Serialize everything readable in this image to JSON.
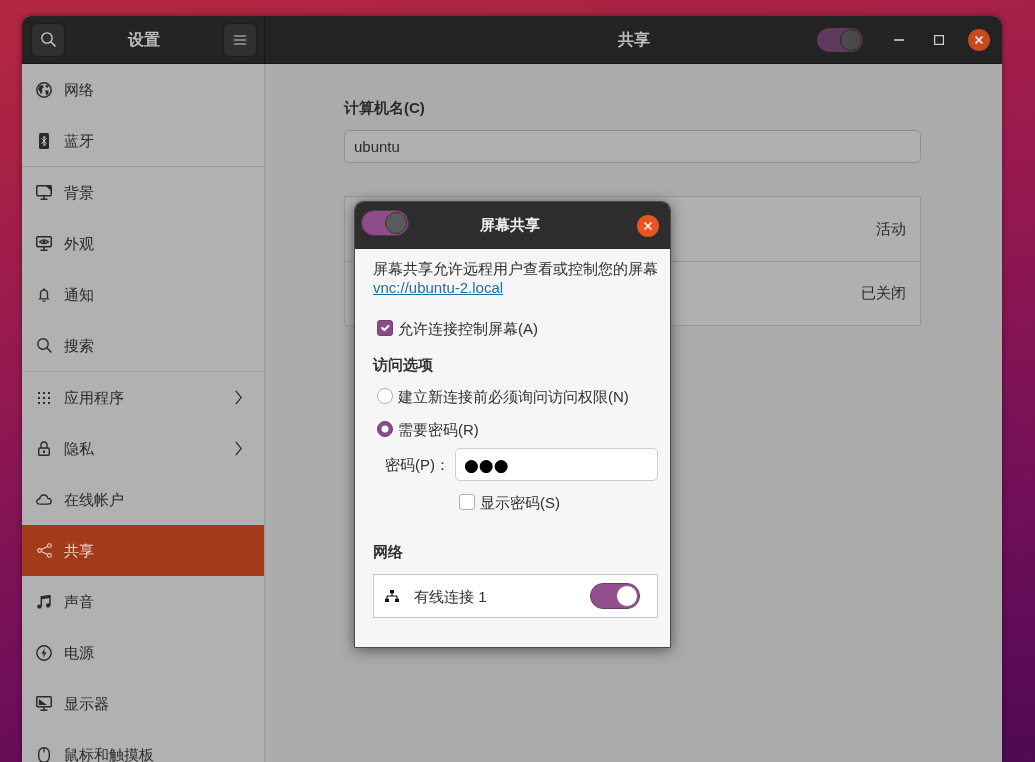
{
  "header": {
    "sidebar_title": "设置",
    "page_title": "共享",
    "sharing_on": true
  },
  "sidebar": {
    "groups": [
      {
        "items": [
          {
            "label": "网络",
            "selected": false,
            "submenu": false
          },
          {
            "label": "蓝牙",
            "selected": false,
            "submenu": false
          }
        ]
      },
      {
        "items": [
          {
            "label": "背景",
            "selected": false,
            "submenu": false
          },
          {
            "label": "外观",
            "selected": false,
            "submenu": false
          },
          {
            "label": "通知",
            "selected": false,
            "submenu": false
          },
          {
            "label": "搜索",
            "selected": false,
            "submenu": false
          }
        ]
      },
      {
        "items": [
          {
            "label": "应用程序",
            "selected": false,
            "submenu": true
          },
          {
            "label": "隐私",
            "selected": false,
            "submenu": true
          },
          {
            "label": "在线帐户",
            "selected": false,
            "submenu": false
          },
          {
            "label": "共享",
            "selected": true,
            "submenu": false
          },
          {
            "label": "声音",
            "selected": false,
            "submenu": false
          },
          {
            "label": "电源",
            "selected": false,
            "submenu": false
          },
          {
            "label": "显示器",
            "selected": false,
            "submenu": false
          },
          {
            "label": "鼠标和触摸板",
            "selected": false,
            "submenu": false
          }
        ]
      }
    ]
  },
  "computer_name": {
    "label": "计算机名(C)",
    "value": "ubuntu"
  },
  "services": [
    {
      "status": "活动"
    },
    {
      "status": "已关闭"
    }
  ],
  "dialog": {
    "title": "屏幕共享",
    "on": true,
    "description": "屏幕共享允许远程用户查看或控制您的屏幕",
    "link": "vnc://ubuntu-2.local",
    "allow_control": {
      "label": "允许连接控制屏幕(A)",
      "checked": true
    },
    "access_heading": "访问选项",
    "access_options": [
      {
        "label": "建立新连接前必须询问访问权限(N)",
        "selected": false
      },
      {
        "label": "需要密码(R)",
        "selected": true
      }
    ],
    "password": {
      "label": "密码(P)：",
      "value": "●●●"
    },
    "show_password": {
      "label": "显示密码(S)",
      "checked": false
    },
    "network_heading": "网络",
    "networks": [
      {
        "name": "有线连接 1",
        "on": true
      }
    ]
  }
}
